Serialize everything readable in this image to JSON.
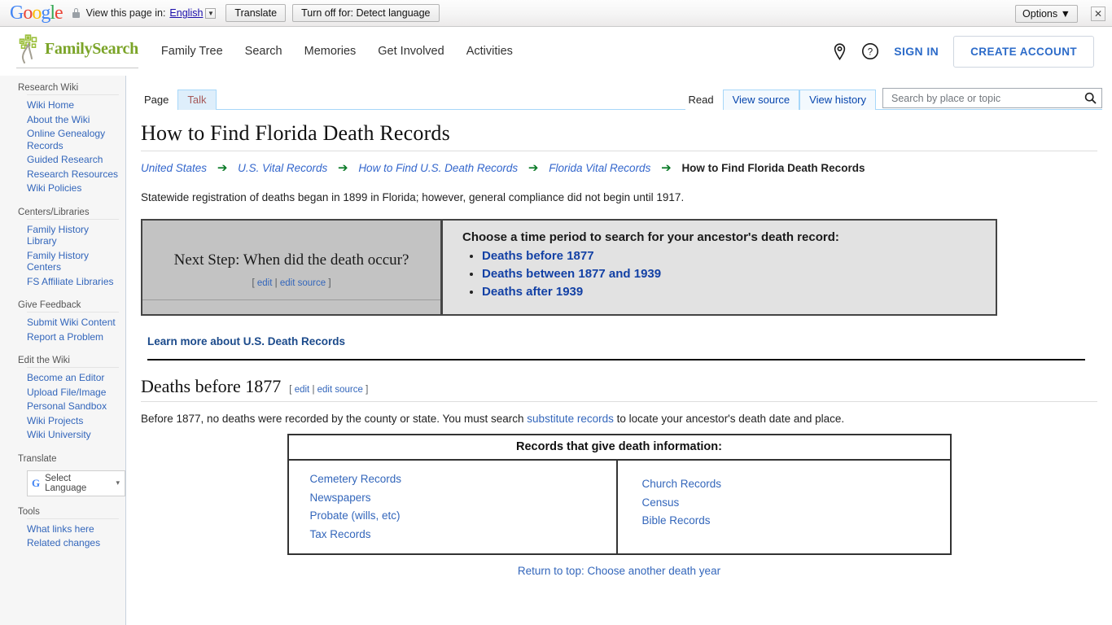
{
  "translate_bar": {
    "logo": "Google",
    "lock_icon": "lock-icon",
    "view_text": "View this page in:",
    "language": "English",
    "translate_button": "Translate",
    "turn_off_button": "Turn off for: Detect language",
    "options_button": "Options",
    "close_icon": "close-icon"
  },
  "header": {
    "logo_text": "FamilySearch",
    "nav": [
      {
        "label": "Family Tree"
      },
      {
        "label": "Search"
      },
      {
        "label": "Memories"
      },
      {
        "label": "Get Involved"
      },
      {
        "label": "Activities"
      }
    ],
    "location_icon": "map-pin-icon",
    "help_icon": "help-circle-icon",
    "sign_in": "SIGN IN",
    "create_account": "CREATE ACCOUNT"
  },
  "sidebar": {
    "groups": [
      {
        "title": "Research Wiki",
        "items": [
          "Wiki Home",
          "About the Wiki",
          "Online Genealogy Records",
          "Guided Research",
          "Research Resources",
          "Wiki Policies"
        ]
      },
      {
        "title": "Centers/Libraries",
        "items": [
          "Family History Library",
          "Family History Centers",
          "FS Affiliate Libraries"
        ]
      },
      {
        "title": "Give Feedback",
        "items": [
          "Submit Wiki Content",
          "Report a Problem"
        ]
      },
      {
        "title": "Edit the Wiki",
        "items": [
          "Become an Editor",
          "Upload File/Image",
          "Personal Sandbox",
          "Wiki Projects",
          "Wiki University"
        ]
      }
    ],
    "translate_title": "Translate",
    "select_language": "Select Language",
    "tools_title": "Tools",
    "tools_items": [
      "What links here",
      "Related changes"
    ]
  },
  "tabs": {
    "left": [
      {
        "label": "Page",
        "state": "active"
      },
      {
        "label": "Talk",
        "state": "new"
      }
    ],
    "right": [
      {
        "label": "Read",
        "state": "active"
      },
      {
        "label": "View source",
        "state": "alt"
      },
      {
        "label": "View history",
        "state": "alt"
      }
    ]
  },
  "search": {
    "placeholder": "Search by place or topic",
    "value": "",
    "icon": "search-icon"
  },
  "page": {
    "title": "How to Find Florida Death Records",
    "breadcrumb": [
      "United States",
      "U.S. Vital Records",
      "How to Find U.S. Death Records",
      "Florida Vital Records"
    ],
    "breadcrumb_current": "How to Find Florida Death Records",
    "breadcrumb_arrow": "➔",
    "intro": "Statewide registration of deaths began in 1899 in Florida; however, general compliance did not begin until 1917."
  },
  "choose_box": {
    "next_step_title": "Next Step: When did the death occur?",
    "edit_links": {
      "open": "[",
      "edit": "edit",
      "sep": "|",
      "edit_source": "edit source",
      "close": "]"
    },
    "prompt": "Choose a time period to search for your ancestor's death record:",
    "options": [
      "Deaths before 1877",
      "Deaths between 1877 and 1939",
      "Deaths after 1939"
    ]
  },
  "learn_more": "Learn more about U.S. Death Records",
  "section": {
    "heading": "Deaths before 1877",
    "paragraph_before": "Before 1877, no deaths were recorded by the county or state. You must search ",
    "paragraph_link": "substitute records",
    "paragraph_after": " to locate your ancestor's death date and place."
  },
  "records_table": {
    "header": "Records that give death information:",
    "left_column": [
      "Cemetery Records",
      "Newspapers",
      "Probate (wills, etc)",
      "Tax Records"
    ],
    "right_column": [
      "Church Records",
      "Census",
      "Bible Records"
    ]
  },
  "return_top": "Return to top: Choose another death year",
  "colors": {
    "brand_green": "#7ba428",
    "link_blue": "#3366bb",
    "bold_link_blue": "#1341a5",
    "breadcrumb_blue": "#3366cc",
    "arrow_green": "#0a7a27",
    "gray_cell": "#c3c3c3"
  }
}
